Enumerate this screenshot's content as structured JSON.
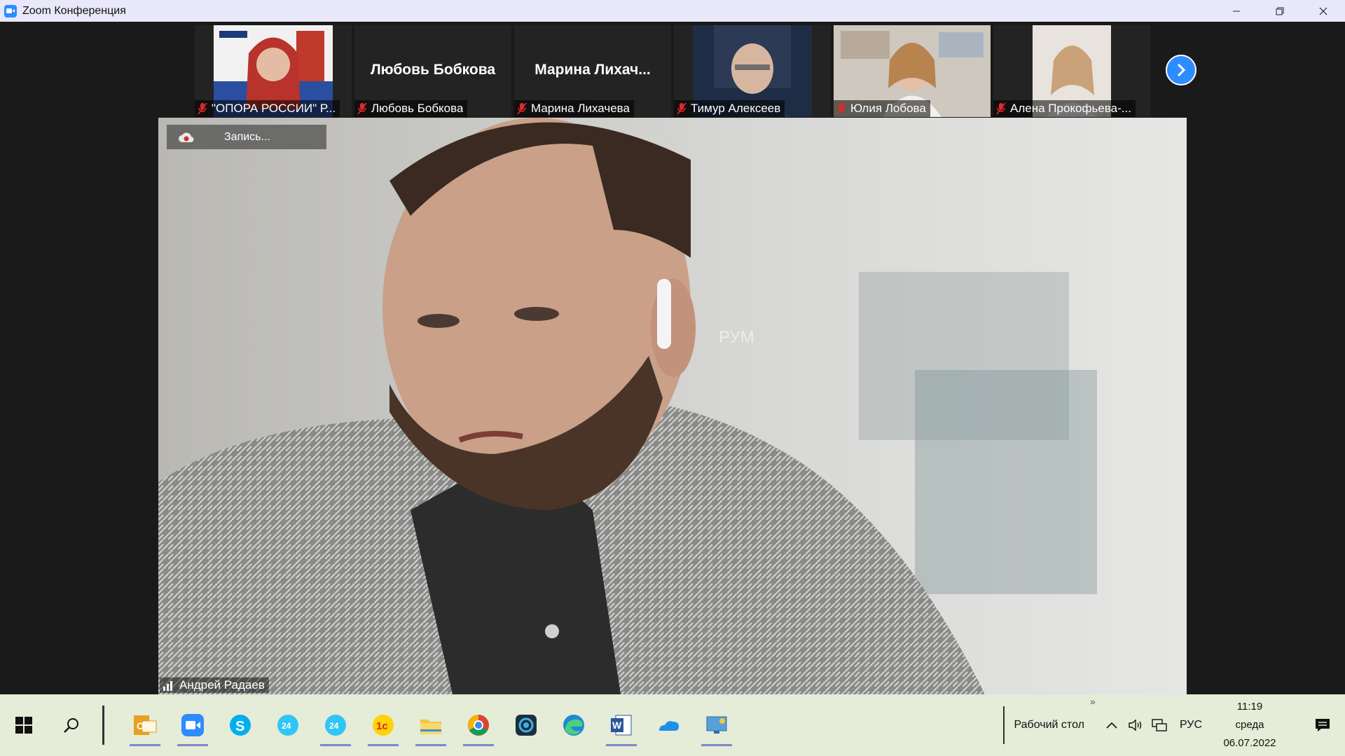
{
  "window": {
    "title": "Zoom Конференция",
    "icon": "zoom-camera-icon",
    "controls": [
      "minimize-icon",
      "restore-icon",
      "close-icon"
    ]
  },
  "participants": [
    {
      "name": "\"ОПОРА РОССИИ\" Р...",
      "has_video": true,
      "muted": true
    },
    {
      "name": "Любовь Бобкова",
      "display_name": "Любовь Бобкова",
      "has_video": false,
      "muted": true
    },
    {
      "name": "Марина Лихачева",
      "display_name": "Марина  Лихач...",
      "has_video": false,
      "muted": true
    },
    {
      "name": "Тимур Алексеев",
      "has_video": true,
      "muted": true
    },
    {
      "name": "Юлия Лобова",
      "has_video": true,
      "muted": true
    },
    {
      "name": "Алена Прокофьева-...",
      "has_video": true,
      "muted": true
    }
  ],
  "speaker": {
    "name": "Андрей Радаев",
    "watermark": "РУМ"
  },
  "recording": {
    "label": "Запись..."
  },
  "taskbar": {
    "apps": [
      "outlook-icon",
      "zoom-icon",
      "skype-icon",
      "bitrix24-icon",
      "bitrix24-icon",
      "1c-icon",
      "file-explorer-icon",
      "chrome-icon",
      "screen-recorder-icon",
      "edge-icon",
      "word-icon",
      "onedrive-icon",
      "remote-desktop-icon"
    ],
    "desktop_label": "Рабочий стол",
    "chevron": "»",
    "language": "РУС",
    "time": "11:19",
    "weekday": "среда",
    "date": "06.07.2022"
  },
  "colors": {
    "titlebar_bg": "#e9e8fb",
    "meeting_bg": "#1a1a1a",
    "zoom_blue": "#2d8cff",
    "muted_red": "#e02828",
    "taskbar_bg": "#e5ecd7"
  }
}
